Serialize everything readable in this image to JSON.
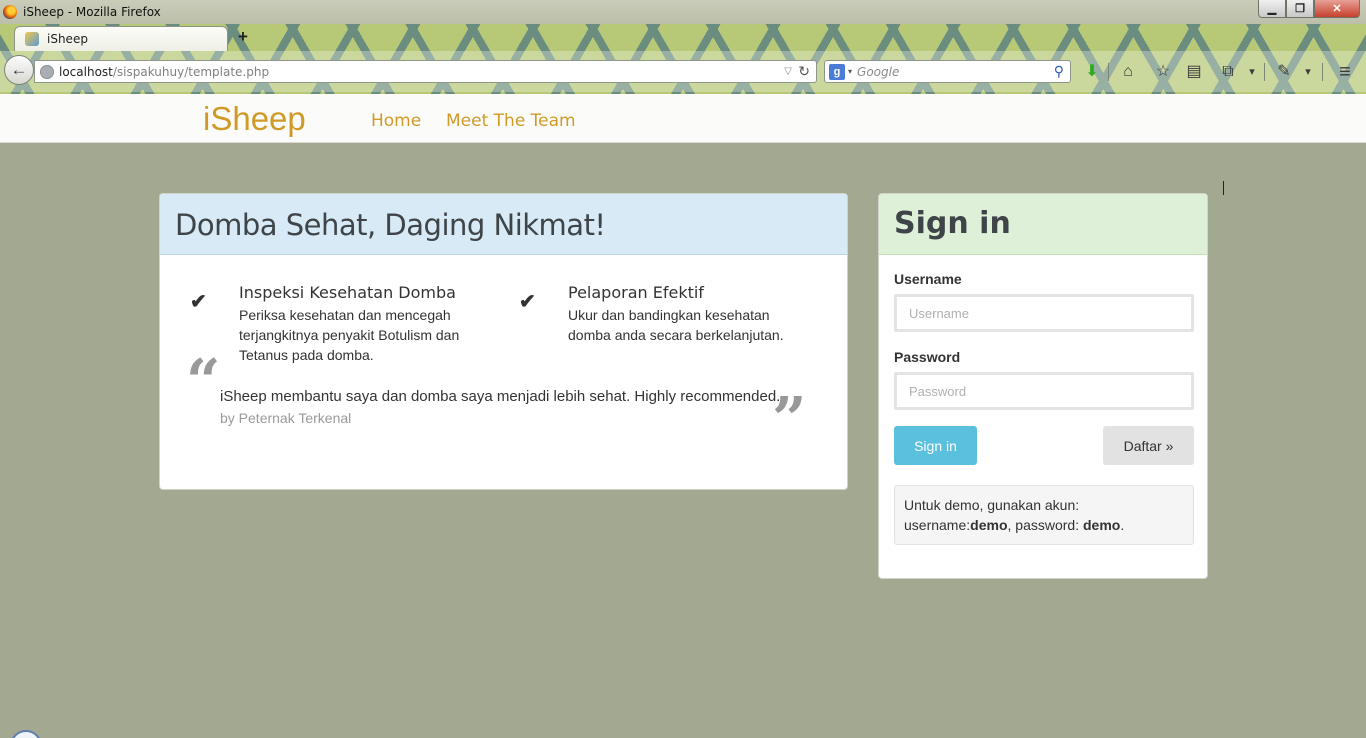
{
  "window": {
    "title": "iSheep - Mozilla Firefox",
    "minimize": "▁",
    "maximize": "❐",
    "close": "✕"
  },
  "tab": {
    "label": "iSheep",
    "new_tab": "+"
  },
  "urlbar": {
    "host": "localhost",
    "path": "/sispakuhuy/template.php",
    "dropdown_icon": "▽",
    "reload_icon": "↻"
  },
  "searchbar": {
    "engine": "g",
    "placeholder": "Google",
    "go_icon": "⚲"
  },
  "toolbar_icons": {
    "download": "⬇",
    "home": "⌂",
    "bookmark": "☆",
    "reader": "▤",
    "screenshot": "⧉",
    "tools": "✎",
    "menu": "≡",
    "dropdown": "▾"
  },
  "site": {
    "brand": "iSheep",
    "nav": [
      {
        "label": "Home"
      },
      {
        "label": "Meet The Team"
      }
    ]
  },
  "main": {
    "title": "Domba Sehat, Daging Nikmat!",
    "features": [
      {
        "check": "✔",
        "title": "Inspeksi Kesehatan Domba",
        "desc": "Periksa kesehatan dan mencegah terjangkitnya penyakit Botulism dan Tetanus pada domba."
      },
      {
        "check": "✔",
        "title": "Pelaporan Efektif",
        "desc": "Ukur dan bandingkan kesehatan domba anda secara berkelanjutan."
      }
    ],
    "quote": {
      "open": "“",
      "close": "”",
      "text": "iSheep membantu saya dan domba saya menjadi lebih sehat. Highly recommended.",
      "author": "by Peternak Terkenal"
    }
  },
  "signin": {
    "title": "Sign in",
    "username_label": "Username",
    "username_placeholder": "Username",
    "password_label": "Password",
    "password_placeholder": "Password",
    "signin_button": "Sign in",
    "register_button": "Daftar »",
    "demo_prefix": "Untuk demo, gunakan akun: username:",
    "demo_user": "demo",
    "demo_mid": ", password: ",
    "demo_pass": "demo",
    "demo_suffix": "."
  }
}
